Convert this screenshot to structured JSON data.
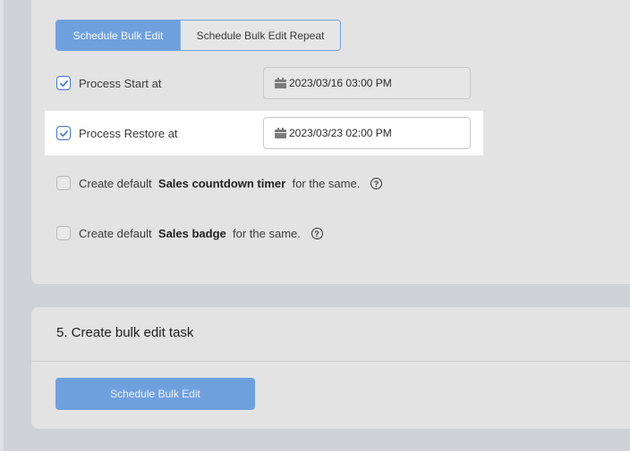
{
  "tabs": {
    "active": "Schedule Bulk Edit",
    "inactive": "Schedule Bulk Edit Repeat"
  },
  "options": [
    {
      "label": "Process Start at",
      "checked": true,
      "date": "2023/03/16 03:00 PM"
    },
    {
      "label": "Process Restore at",
      "checked": true,
      "date": "2023/03/23 02:00 PM"
    }
  ],
  "defaults": {
    "countdown": {
      "prefix": "Create default",
      "bold": "Sales countdown timer",
      "suffix": "for the same.",
      "help": "?"
    },
    "badge": {
      "prefix": "Create default",
      "bold": "Sales badge",
      "suffix": "for the same.",
      "help": "?"
    }
  },
  "section5": {
    "title": "5. Create bulk edit task",
    "button": "Schedule Bulk Edit"
  },
  "colors": {
    "accent": "#6fa0de",
    "check": "#3f76d0",
    "panel": "#e3e3e3",
    "background": "#cfd3d8"
  },
  "icons": {
    "calendar": "calendar-icon",
    "check": "checkmark-icon",
    "help": "help-circle-icon"
  }
}
